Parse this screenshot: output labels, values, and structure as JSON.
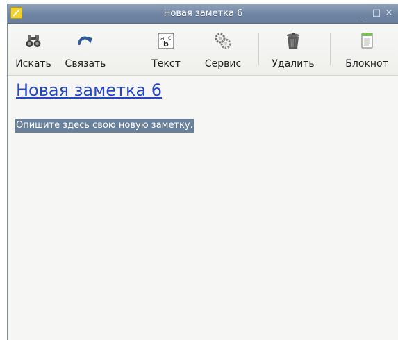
{
  "window": {
    "title": "Новая заметка 6"
  },
  "titlebar_buttons": {
    "minimize": "_",
    "maximize": "□",
    "close": "×"
  },
  "toolbar": {
    "search_label": "Искать",
    "link_label": "Связать",
    "text_label": "Текст",
    "tools_label": "Сервис",
    "delete_label": "Удалить",
    "notebook_label": "Блокнот"
  },
  "note": {
    "title": "Новая заметка 6",
    "body": "Опишите здесь свою новую заметку."
  }
}
